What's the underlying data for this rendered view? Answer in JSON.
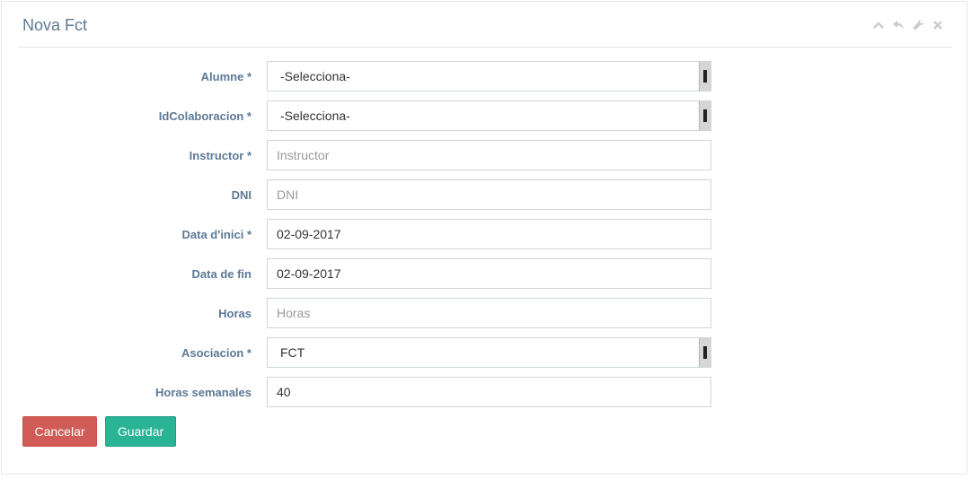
{
  "panel": {
    "title": "Nova Fct",
    "toolbar": [
      {
        "icon": "chevron-up-icon"
      },
      {
        "icon": "reply-icon"
      },
      {
        "icon": "wrench-icon"
      },
      {
        "icon": "close-icon"
      }
    ]
  },
  "form": {
    "alumne": {
      "label": "Alumne *",
      "value": "-Selecciona-"
    },
    "idcolaboracion": {
      "label": "IdColaboracion *",
      "value": "-Selecciona-"
    },
    "instructor": {
      "label": "Instructor *",
      "placeholder": "Instructor"
    },
    "dni": {
      "label": "DNI",
      "placeholder": "DNI"
    },
    "data_inici": {
      "label": "Data d'inici *",
      "value": "02-09-2017"
    },
    "data_fin": {
      "label": "Data de fin",
      "value": "02-09-2017"
    },
    "horas": {
      "label": "Horas",
      "placeholder": "Horas"
    },
    "asociacion": {
      "label": "Asociacion *",
      "value": "FCT"
    },
    "horas_semanales": {
      "label": "Horas semanales",
      "value": "40"
    }
  },
  "buttons": {
    "cancel": "Cancelar",
    "save": "Guardar"
  },
  "colors": {
    "cancel": "#d15b56",
    "save": "#2ab395",
    "label": "#5d7996",
    "title": "#5e7a92"
  }
}
